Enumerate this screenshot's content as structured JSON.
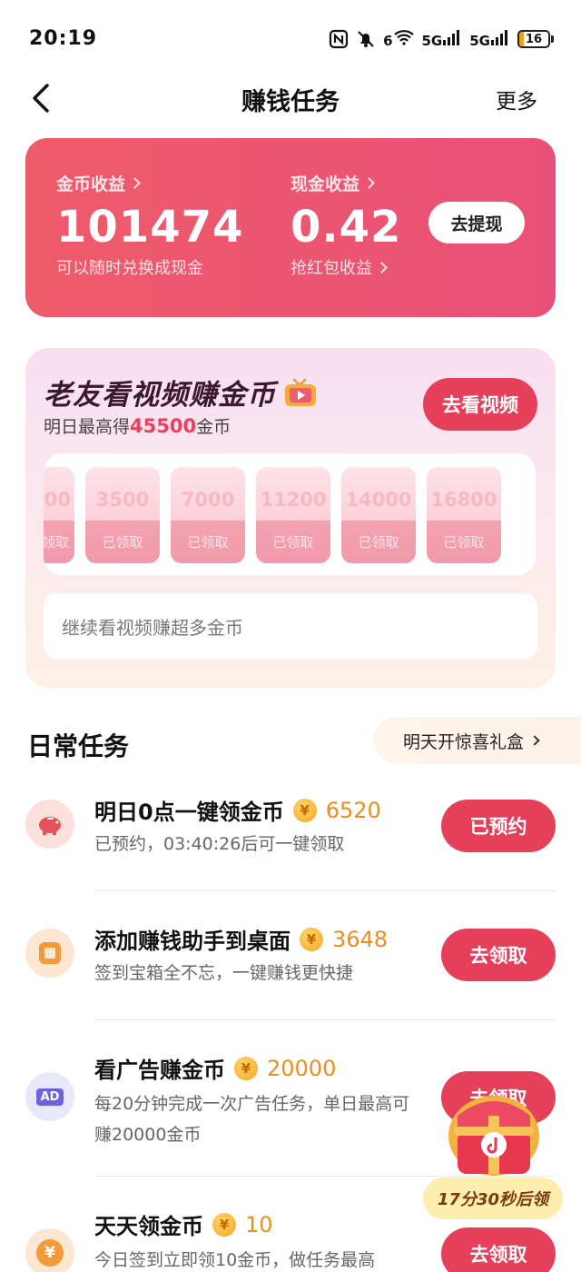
{
  "status_bar": {
    "time": "20:19",
    "battery": "16",
    "battery_level": 0.16,
    "signal_1": "5G",
    "signal_2": "5G",
    "wifi": "6"
  },
  "nav": {
    "title": "赚钱任务",
    "more": "更多"
  },
  "earnings": {
    "coin_label": "金币收益",
    "coin_value": "101474",
    "coin_note": "可以随时兑换成现金",
    "cash_label": "现金收益",
    "cash_value": "0.42",
    "cash_note": "抢红包收益",
    "withdraw": "去提现"
  },
  "video": {
    "title": "老友看视频赚金币",
    "sub_prefix": "明日最高得",
    "sub_amount": "45500",
    "sub_suffix": "金币",
    "watch_button": "去看视频",
    "rewards": [
      {
        "amount": "00",
        "status": "领取"
      },
      {
        "amount": "3500",
        "status": "已领取"
      },
      {
        "amount": "7000",
        "status": "已领取"
      },
      {
        "amount": "11200",
        "status": "已领取"
      },
      {
        "amount": "14000",
        "status": "已领取"
      },
      {
        "amount": "16800",
        "status": "已领取"
      }
    ],
    "continue_text": "继续看视频赚超多金币"
  },
  "daily": {
    "title": "日常任务",
    "gift_link": "明天开惊喜礼盒",
    "tasks": [
      {
        "name": "明日0点一键领金币",
        "coins": "6520",
        "desc": "已预约，03:40:26后可一键领取",
        "button": "已预约",
        "icon": "piggy-bank-icon"
      },
      {
        "name": "添加赚钱助手到桌面",
        "coins": "3648",
        "desc": "签到宝箱全不忘，一键赚钱更快捷",
        "button": "去领取",
        "icon": "desktop-widget-icon"
      },
      {
        "name": "看广告赚金币",
        "coins": "20000",
        "desc": "每20分钟完成一次广告任务，单日最高可赚20000金币",
        "button": "去领取",
        "icon": "ad-icon",
        "icon_text": "AD"
      },
      {
        "name": "天天领金币",
        "coins": "10",
        "desc": "今日签到立即领10金币，做任务最高",
        "button": "去领取",
        "icon": "yuan-coin-icon"
      }
    ]
  },
  "coin_symbol": "¥",
  "treasure": {
    "label": "17分30秒后领"
  },
  "colors": {
    "accent": "#e63f5a",
    "card_red": "#ec5572",
    "coin_orange": "#ef8d1c"
  }
}
